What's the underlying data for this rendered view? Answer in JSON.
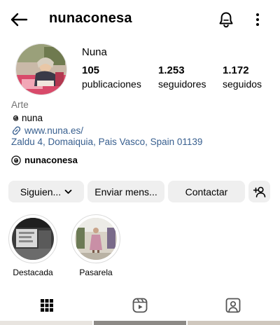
{
  "header": {
    "username": "nunaconesa"
  },
  "profile": {
    "name": "Nuna",
    "stats": [
      {
        "value": "105",
        "label": "publicaciones"
      },
      {
        "value": "1.253",
        "label": "seguidores"
      },
      {
        "value": "1.172",
        "label": "seguidos"
      }
    ],
    "bio": {
      "category": "Arte",
      "threads_handle": "nuna",
      "link": "www.nuna.es/",
      "address": "Zaldu 4, Domaiquia, Pais Vasco, Spain 01139"
    },
    "threads_badge": "nunaconesa"
  },
  "actions": {
    "follow_label": "Siguien...",
    "message_label": "Enviar mens...",
    "contact_label": "Contactar"
  },
  "highlights": [
    {
      "label": "Destacada"
    },
    {
      "label": "Pasarela"
    }
  ],
  "tabs": [
    {
      "icon": "grid-icon",
      "active": true
    },
    {
      "icon": "reels-icon",
      "active": false
    },
    {
      "icon": "tagged-icon",
      "active": false
    }
  ],
  "colors": {
    "link": "#385f8f",
    "muted": "#737373",
    "button_bg": "#efefef",
    "highlight_ring": "#dbdbdb"
  }
}
